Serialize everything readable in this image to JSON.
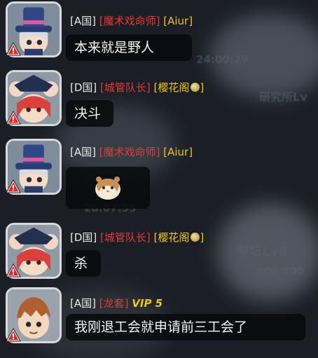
{
  "messages": [
    {
      "country": "[A国]",
      "title": "[魔术戏命师]",
      "name": "[Aiur]",
      "text": "本来就是野人",
      "avatar": "magician-avatar"
    },
    {
      "country": "[D国]",
      "title": "[城管队长]",
      "name": "[樱花阁",
      "name_suffix": "]",
      "text": "决斗",
      "avatar": "mouse-pirate-avatar"
    },
    {
      "country": "[A国]",
      "title": "[魔术戏命师]",
      "name": "[Aiur]",
      "text": "",
      "sticker": "hamster-sticker",
      "avatar": "magician-avatar"
    },
    {
      "country": "[D国]",
      "title": "[城管队长]",
      "name": "[樱花阁",
      "name_suffix": "]",
      "text": "杀",
      "avatar": "mouse-pirate-avatar"
    },
    {
      "country": "[A国]",
      "title": "[龙套]",
      "vip": "VIP 5",
      "text": "我刚退工会就申请前三工会了",
      "avatar": "brown-hair-avatar"
    }
  ],
  "background": {
    "timer1": "24:00:29",
    "timer2": "28:07:35",
    "building1": "研究所Lv",
    "building2": "祭坛Lv8",
    "hp": "800/800"
  }
}
